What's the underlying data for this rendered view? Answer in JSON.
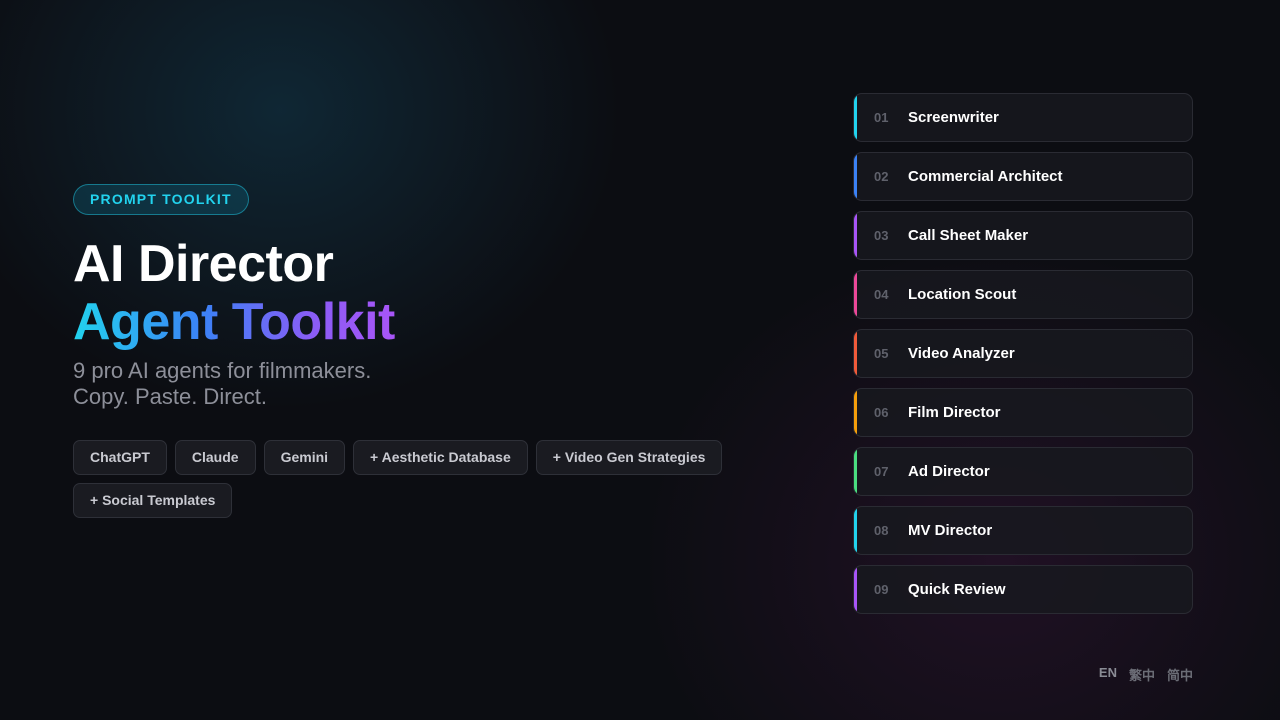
{
  "hero": {
    "badge": "PROMPT TOOLKIT",
    "title_line1": "AI Director",
    "title_line2": "Agent Toolkit",
    "subtitle_line1": "9 pro AI agents for filmmakers.",
    "subtitle_line2": "Copy. Paste. Direct.",
    "title_gradient": [
      "#22d3ee",
      "#3b82f6",
      "#8b5cf6",
      "#a855f7"
    ]
  },
  "chips": [
    "ChatGPT",
    "Claude",
    "Gemini",
    "+ Aesthetic Database",
    "+ Video Gen Strategies",
    "+ Social Templates"
  ],
  "agents": [
    {
      "num": "01",
      "name": "Screenwriter",
      "color": "#22d3ee"
    },
    {
      "num": "02",
      "name": "Commercial Architect",
      "color": "#3b82f6"
    },
    {
      "num": "03",
      "name": "Call Sheet Maker",
      "color": "#a855f7"
    },
    {
      "num": "04",
      "name": "Location Scout",
      "color": "#ec4899"
    },
    {
      "num": "05",
      "name": "Video Analyzer",
      "color": "#f05a3a"
    },
    {
      "num": "06",
      "name": "Film Director",
      "color": "#f59e0b"
    },
    {
      "num": "07",
      "name": "Ad Director",
      "color": "#4ade80"
    },
    {
      "num": "08",
      "name": "MV Director",
      "color": "#22d3ee"
    },
    {
      "num": "09",
      "name": "Quick Review",
      "color": "#a855f7"
    }
  ],
  "languages": {
    "en": "EN",
    "zh_hant": "繁中",
    "zh_hans": "简中"
  }
}
